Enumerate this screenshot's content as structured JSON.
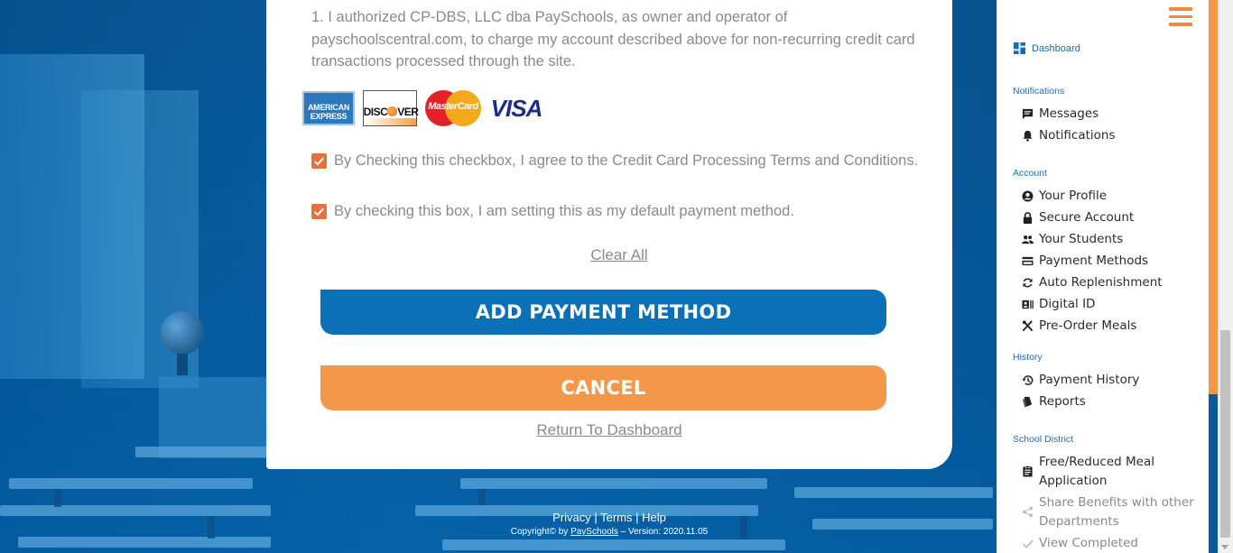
{
  "terms": {
    "text": "1. I authorized CP-DBS, LLC dba PaySchools, as owner and operator of payschoolscentral.com, to charge my account described above for non-recurring credit card transactions processed through the site."
  },
  "card_logos": {
    "amex": "AMERICAN EXPRESS",
    "discover_pre": "DISC",
    "discover_post": "VER",
    "mastercard": "MasterCard",
    "visa": "VISA"
  },
  "checkboxes": {
    "agree_terms": "By Checking this checkbox, I agree to the Credit Card Processing Terms and Conditions.",
    "default_method": "By checking this box, I am setting this as my default payment method."
  },
  "actions": {
    "clear_all": "Clear All",
    "add_payment": "ADD PAYMENT METHOD",
    "cancel": "CANCEL",
    "return_dashboard": "Return To Dashboard"
  },
  "footer": {
    "privacy": "Privacy",
    "terms": "Terms",
    "help": "Help",
    "sep": "|",
    "copyright_pre": "Copyright© by",
    "brand": "PaySchools",
    "version": "– Version: 2020.11.05"
  },
  "sidebar": {
    "dashboard": "Dashboard",
    "notifications_title": "Notifications",
    "messages": "Messages",
    "notifications": "Notifications",
    "account_title": "Account",
    "your_profile": "Your Profile",
    "secure_account": "Secure Account",
    "your_students": "Your Students",
    "payment_methods": "Payment Methods",
    "auto_replenishment": "Auto Replenishment",
    "digital_id": "Digital ID",
    "pre_order_meals": "Pre-Order Meals",
    "history_title": "History",
    "payment_history": "Payment History",
    "reports": "Reports",
    "district_title": "School District",
    "free_reduced_line1": "Free/Reduced Meal",
    "free_reduced_line2": "Application",
    "share_benefits_line1": "Share Benefits with other",
    "share_benefits_line2": "Departments",
    "view_completed": "View Completed Application"
  },
  "colors": {
    "primary_blue": "#0a70b8",
    "orange": "#f49748",
    "checkbox": "#e8703a"
  }
}
